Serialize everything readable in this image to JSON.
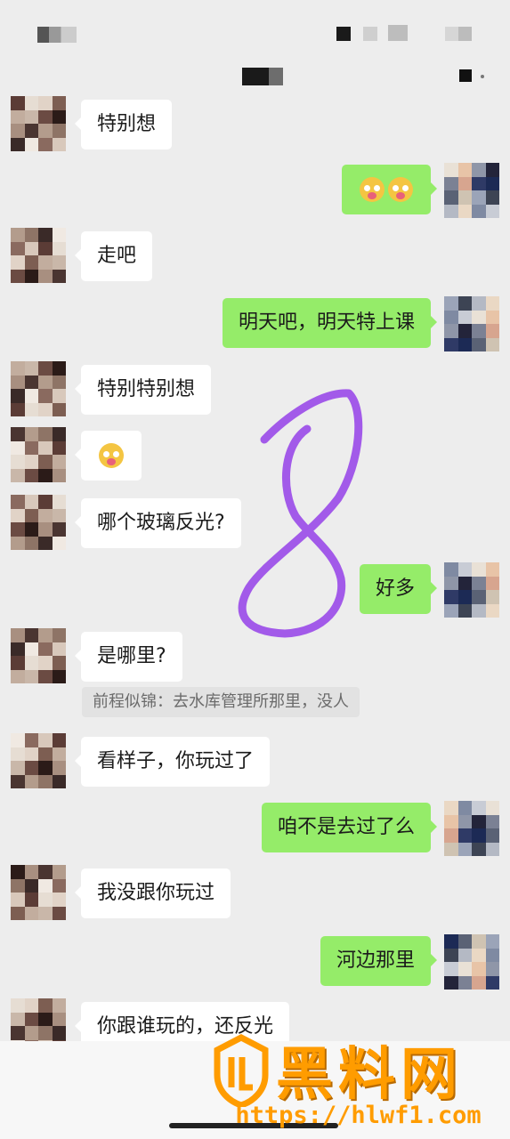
{
  "chat": {
    "messages": [
      {
        "side": "in",
        "text": "特别想"
      },
      {
        "side": "out",
        "emoji": [
          "flushed-face-emoji",
          "flushed-face-emoji"
        ]
      },
      {
        "side": "in",
        "text": "走吧"
      },
      {
        "side": "out",
        "text": "明天吧，明天特上课"
      },
      {
        "side": "in",
        "text": "特别特别想"
      },
      {
        "side": "in",
        "emoji": [
          "flushed-face-emoji"
        ]
      },
      {
        "side": "in",
        "text": "哪个玻璃反光?"
      },
      {
        "side": "out",
        "text": "好多"
      },
      {
        "side": "in",
        "text": "是哪里?"
      },
      {
        "side": "in",
        "text": "看样子，你玩过了"
      },
      {
        "side": "out",
        "text": "咱不是去过了么"
      },
      {
        "side": "in",
        "text": "我没跟你玩过"
      },
      {
        "side": "out",
        "text": "河边那里"
      },
      {
        "side": "in",
        "text": "你跟谁玩的，还反光"
      }
    ],
    "quote": {
      "author": "前程似锦",
      "text": "：去水库管理所那里，没人"
    }
  },
  "watermark": {
    "brand": "黑料网",
    "url": "https://hlwf1.com"
  },
  "colors": {
    "background": "#ededed",
    "bubble_in": "#ffffff",
    "bubble_out": "#95ec69",
    "scribble": "#9b4de8",
    "watermark": "#ff9c00"
  }
}
